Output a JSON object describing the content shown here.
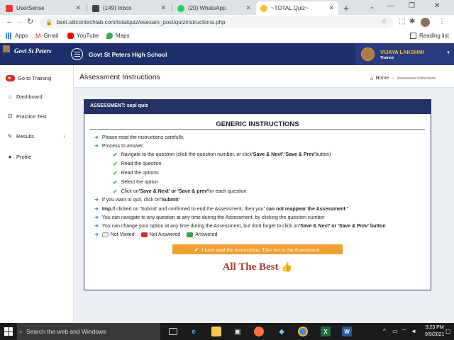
{
  "browser": {
    "tabs": [
      {
        "label": "UserSense",
        "color": "#e53935"
      },
      {
        "label": "(149) Inbox",
        "color": "#444444"
      },
      {
        "label": "(20) WhatsApp",
        "color": "#25d366"
      },
      {
        "label": "~TOTAL Quiz~",
        "color": "#fbc02d"
      }
    ],
    "url": "bset.silicontechlab.com/totalquiz/esexam_post/quizinstructions.php",
    "bookmarks": [
      "Apps",
      "Gmail",
      "YouTube",
      "Maps"
    ],
    "reading_list": "Reading list"
  },
  "app": {
    "logo_text": "Govt St Peters",
    "school_name": "Govt St Peters High School",
    "user_name": "VIJAYA LAKSHMI",
    "user_role": "Trainee",
    "nav": [
      {
        "label": "Go to Training",
        "icon": "play-pill-icon"
      },
      {
        "label": "Dashboard",
        "icon": "dashboard-icon"
      },
      {
        "label": "Practice Test",
        "icon": "checkbox-icon"
      },
      {
        "label": "Results",
        "icon": "wrench-icon"
      },
      {
        "label": "Profile",
        "icon": "user-icon"
      }
    ]
  },
  "page": {
    "title": "Assessment Instructions",
    "breadcrumb_home": "Home",
    "breadcrumb_current": "Assessment Instructions",
    "box_header": "ASSESSMENT: sepl quiz",
    "section_title": "GENERIC INSTRUCTIONS",
    "instructions": {
      "i1": "Please read the instructions carefully.",
      "i2": "Process to answer.",
      "s1a": "Navigate to the question (click the question number, or click ",
      "s1b": "'Save & Next'",
      "s1c": ", ",
      "s1d": "'Save & Prev'",
      "s1e": " button)",
      "s2": "Read the question",
      "s3": "Read the options",
      "s4": "Select the option",
      "s5a": "Click on ",
      "s5b": "'Save & Next' or 'Save & prev'",
      "s5c": " for each question",
      "i3a": "If you want to quit, click on ",
      "i3b": "'Submit'",
      "i4a": "Imp.",
      "i4b": "If clicked on 'Submit' and confirmed to end the Assessment, then you ",
      "i4c": "' can not reappear the Assessment '",
      "i5": "You can navigate to any question at any time during the Assessment, by clicking the question number",
      "i6a": "You can change your option at any time during the Assessment, but dont forget to click on ",
      "i6b": "'Save & Next' or 'Save & Prev' button"
    },
    "legend": {
      "not_visited": "Not Visited",
      "not_answered": "Not Answered",
      "answered": "Answered"
    },
    "start_button": "I have read the instructions. Take me to the Assessment.",
    "best_text": "All The Best"
  },
  "taskbar": {
    "search_placeholder": "Search the web and Windows",
    "time": "3:23 PM",
    "date": "9/9/2021"
  }
}
